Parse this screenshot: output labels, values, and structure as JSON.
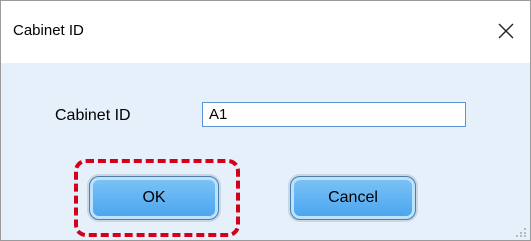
{
  "dialog": {
    "title": "Cabinet ID",
    "close_icon": "close-icon"
  },
  "form": {
    "label": "Cabinet ID",
    "value": "A1"
  },
  "buttons": {
    "ok_label": "OK",
    "cancel_label": "Cancel"
  },
  "colors": {
    "highlight": "#d4001a",
    "button_fill": "#48a3ee",
    "body_background": "#e6f0fb",
    "input_border": "#5a93d6"
  }
}
